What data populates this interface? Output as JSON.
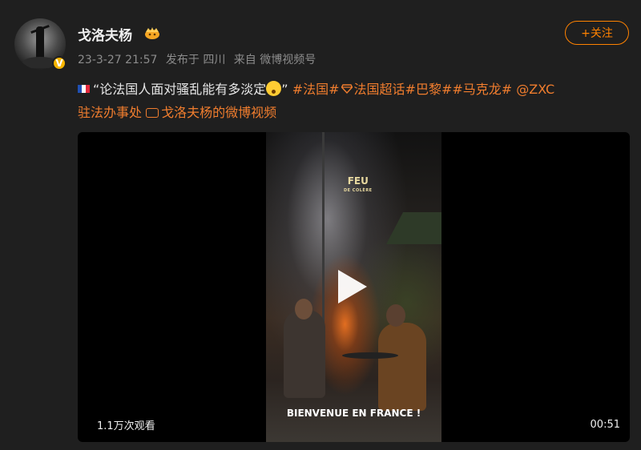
{
  "user": {
    "name": "戈洛夫杨",
    "verified_badge": "V"
  },
  "follow_button": {
    "label": "+关注"
  },
  "meta": {
    "timestamp": "23-3-27 21:57",
    "location": "发布于 四川",
    "source": "来自 微博视频号"
  },
  "post": {
    "quote_text": "“论法国人面对骚乱能有多淡定",
    "quote_close": "”",
    "tag1": "#法国#",
    "tag2": "法国超话",
    "tag3": "#巴黎#",
    "tag4": "#马克龙#",
    "mention_line1": "@ZXC",
    "mention_line2": "驻法办事处",
    "video_link": "戈洛夫杨的微博视频"
  },
  "video": {
    "overlay_title": "FEU",
    "overlay_subtitle": "DE COLÈRE",
    "caption": "BIENVENUE EN FRANCE !",
    "views": "1.1万次观看",
    "duration": "00:51"
  },
  "colors": {
    "accent": "#ff8200",
    "link": "#f07d2e",
    "background": "#1f1f1f",
    "meta_text": "#8c8c8c"
  }
}
